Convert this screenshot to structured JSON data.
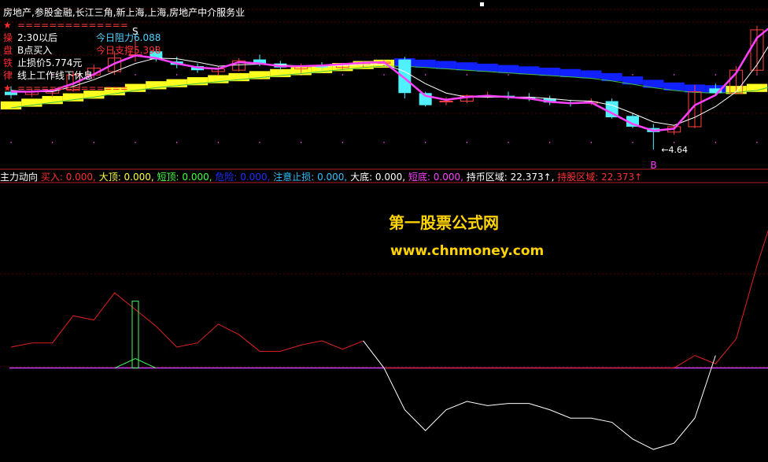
{
  "title": "房地产,参股金融,长江三角,新上海,上海,房地产中介服务业",
  "legend_rows": [
    {
      "tag": "★",
      "value": "==============",
      "style": "sep"
    },
    {
      "tag": "操",
      "value": "2:30以后",
      "style": "val"
    },
    {
      "tag": "盘",
      "value": "B点买入",
      "style": "val"
    },
    {
      "tag": "铁",
      "value": "止损价5.774元",
      "style": "val"
    },
    {
      "tag": "律",
      "value": "线上工作线下休息",
      "style": "val"
    },
    {
      "tag": "★",
      "value": "==============",
      "style": "sep"
    }
  ],
  "resistance_label": "今日阻力6.088",
  "support_label": "今日支撑5.398",
  "marker_s": "S",
  "marker_b": "B",
  "low_price": "←4.64",
  "indicator_name": "主力动向",
  "indicator_values": [
    {
      "label": "买入: 0.000,",
      "color": "#ff3030"
    },
    {
      "label": "大顶: 0.000,",
      "color": "#ffff40"
    },
    {
      "label": "短顶: 0.000,",
      "color": "#40ff40"
    },
    {
      "label": "危险: 0.000,",
      "color": "#2030ff"
    },
    {
      "label": "注意止损: 0.000,",
      "color": "#30c0ff"
    },
    {
      "label": "大底: 0.000,",
      "color": "#ffffff"
    },
    {
      "label": "短底: 0.000,",
      "color": "#ff40ff"
    },
    {
      "label": "持币区域: 22.373↑,",
      "color": "#ffffff"
    },
    {
      "label": "持股区域: 22.373↑",
      "color": "#ff3030"
    }
  ],
  "watermark_title": "第一股票公式网",
  "watermark_url": "www.chnmoney.com",
  "colors": {
    "up": "#ff4040",
    "down": "#50f0ff",
    "ma_fast": "#ffffff",
    "ma_trend": "#ff40ff",
    "ma_slow": "#40c040",
    "band_yellow": "#ffff20",
    "band_blue": "#1020ff",
    "ind_red": "#e02020",
    "ind_white": "#ffffff",
    "ind_green": "#40ff60",
    "ind_zero": "#d040ff"
  },
  "chart_data": [
    {
      "type": "candlestick",
      "candles": [
        {
          "o": 5.5,
          "h": 5.58,
          "l": 5.4,
          "c": 5.45
        },
        {
          "o": 5.46,
          "h": 5.55,
          "l": 5.42,
          "c": 5.5
        },
        {
          "o": 5.48,
          "h": 5.55,
          "l": 5.42,
          "c": 5.52
        },
        {
          "o": 5.52,
          "h": 5.8,
          "l": 5.5,
          "c": 5.75
        },
        {
          "o": 5.75,
          "h": 5.9,
          "l": 5.7,
          "c": 5.85
        },
        {
          "o": 5.8,
          "h": 6.1,
          "l": 5.75,
          "c": 6.0
        },
        {
          "o": 6.05,
          "h": 6.3,
          "l": 5.95,
          "c": 6.05
        },
        {
          "o": 6.1,
          "h": 6.18,
          "l": 5.95,
          "c": 5.98
        },
        {
          "o": 5.95,
          "h": 6.02,
          "l": 5.85,
          "c": 5.9
        },
        {
          "o": 5.88,
          "h": 5.92,
          "l": 5.78,
          "c": 5.82
        },
        {
          "o": 5.8,
          "h": 5.88,
          "l": 5.74,
          "c": 5.84
        },
        {
          "o": 5.82,
          "h": 6.0,
          "l": 5.8,
          "c": 5.96
        },
        {
          "o": 5.98,
          "h": 6.05,
          "l": 5.88,
          "c": 5.92
        },
        {
          "o": 5.92,
          "h": 5.96,
          "l": 5.82,
          "c": 5.86
        },
        {
          "o": 5.84,
          "h": 5.92,
          "l": 5.78,
          "c": 5.88
        },
        {
          "o": 5.88,
          "h": 5.94,
          "l": 5.82,
          "c": 5.86
        },
        {
          "o": 5.86,
          "h": 5.93,
          "l": 5.83,
          "c": 5.9
        },
        {
          "o": 5.9,
          "h": 5.95,
          "l": 5.86,
          "c": 5.92
        },
        {
          "o": 5.92,
          "h": 5.97,
          "l": 5.88,
          "c": 5.94
        },
        {
          "o": 5.98,
          "h": 6.02,
          "l": 5.4,
          "c": 5.48
        },
        {
          "o": 5.48,
          "h": 5.5,
          "l": 5.28,
          "c": 5.3
        },
        {
          "o": 5.35,
          "h": 5.42,
          "l": 5.3,
          "c": 5.36
        },
        {
          "o": 5.36,
          "h": 5.46,
          "l": 5.33,
          "c": 5.44
        },
        {
          "o": 5.44,
          "h": 5.5,
          "l": 5.4,
          "c": 5.44
        },
        {
          "o": 5.44,
          "h": 5.5,
          "l": 5.38,
          "c": 5.42
        },
        {
          "o": 5.42,
          "h": 5.48,
          "l": 5.36,
          "c": 5.4
        },
        {
          "o": 5.4,
          "h": 5.44,
          "l": 5.3,
          "c": 5.34
        },
        {
          "o": 5.34,
          "h": 5.38,
          "l": 5.28,
          "c": 5.33
        },
        {
          "o": 5.33,
          "h": 5.4,
          "l": 5.3,
          "c": 5.35
        },
        {
          "o": 5.36,
          "h": 5.4,
          "l": 5.1,
          "c": 5.12
        },
        {
          "o": 5.14,
          "h": 5.18,
          "l": 4.96,
          "c": 4.98
        },
        {
          "o": 4.96,
          "h": 5.02,
          "l": 4.64,
          "c": 4.9
        },
        {
          "o": 4.9,
          "h": 5.0,
          "l": 4.86,
          "c": 4.98
        },
        {
          "o": 4.98,
          "h": 5.6,
          "l": 4.96,
          "c": 5.5
        },
        {
          "o": 5.55,
          "h": 5.62,
          "l": 5.45,
          "c": 5.48
        },
        {
          "o": 5.48,
          "h": 5.88,
          "l": 5.46,
          "c": 5.82
        },
        {
          "o": 5.82,
          "h": 6.48,
          "l": 5.76,
          "c": 6.42
        }
      ],
      "ma_fast": [
        5.52,
        5.5,
        5.5,
        5.58,
        5.68,
        5.8,
        5.92,
        6.0,
        5.99,
        5.94,
        5.88,
        5.9,
        5.91,
        5.9,
        5.88,
        5.88,
        5.89,
        5.9,
        5.91,
        5.8,
        5.62,
        5.48,
        5.42,
        5.42,
        5.42,
        5.42,
        5.4,
        5.37,
        5.36,
        5.3,
        5.18,
        5.05,
        5.0,
        5.12,
        5.28,
        5.5,
        5.9,
        6.4
      ],
      "ma_trend": [
        5.5,
        5.5,
        5.52,
        5.62,
        5.76,
        5.92,
        6.04,
        6.0,
        5.92,
        5.86,
        5.84,
        5.94,
        5.92,
        5.88,
        5.88,
        5.89,
        5.91,
        5.93,
        5.94,
        5.7,
        5.44,
        5.38,
        5.42,
        5.44,
        5.42,
        5.4,
        5.35,
        5.33,
        5.34,
        5.18,
        5.02,
        4.92,
        4.95,
        5.3,
        5.45,
        5.78,
        6.3,
        6.55
      ],
      "ma_slow": [
        5.26,
        5.3,
        5.34,
        5.38,
        5.42,
        5.47,
        5.52,
        5.56,
        5.59,
        5.62,
        5.65,
        5.68,
        5.71,
        5.74,
        5.77,
        5.8,
        5.83,
        5.86,
        5.88,
        5.88,
        5.86,
        5.84,
        5.82,
        5.8,
        5.78,
        5.76,
        5.74,
        5.72,
        5.7,
        5.66,
        5.61,
        5.56,
        5.52,
        5.49,
        5.48,
        5.49,
        5.52,
        5.6
      ],
      "ylim": [
        4.5,
        6.7
      ]
    },
    {
      "type": "line",
      "title": "主力动向",
      "red": [
        4.0,
        4.2,
        4.2,
        5.5,
        5.3,
        6.6,
        5.8,
        5.0,
        4.0,
        4.2,
        5.1,
        4.6,
        3.8,
        3.8,
        4.1,
        4.3,
        3.9,
        4.3,
        null,
        null,
        null,
        null,
        null,
        null,
        null,
        null,
        null,
        null,
        null,
        null,
        null,
        null,
        3.0,
        3.6,
        3.2,
        4.4,
        7.9,
        11.0
      ],
      "white": [
        null,
        null,
        null,
        null,
        null,
        null,
        null,
        null,
        null,
        null,
        null,
        null,
        null,
        null,
        null,
        null,
        null,
        4.3,
        3.0,
        1.0,
        0.0,
        1.0,
        1.4,
        1.2,
        1.3,
        1.3,
        1.0,
        0.6,
        0.6,
        0.4,
        -0.4,
        -0.9,
        -0.6,
        0.6,
        3.6,
        null,
        null,
        null
      ],
      "green_bar": {
        "index": 6,
        "value": 6.2
      },
      "zero": 3.0,
      "ylim": [
        -1.2,
        11.5
      ]
    }
  ]
}
